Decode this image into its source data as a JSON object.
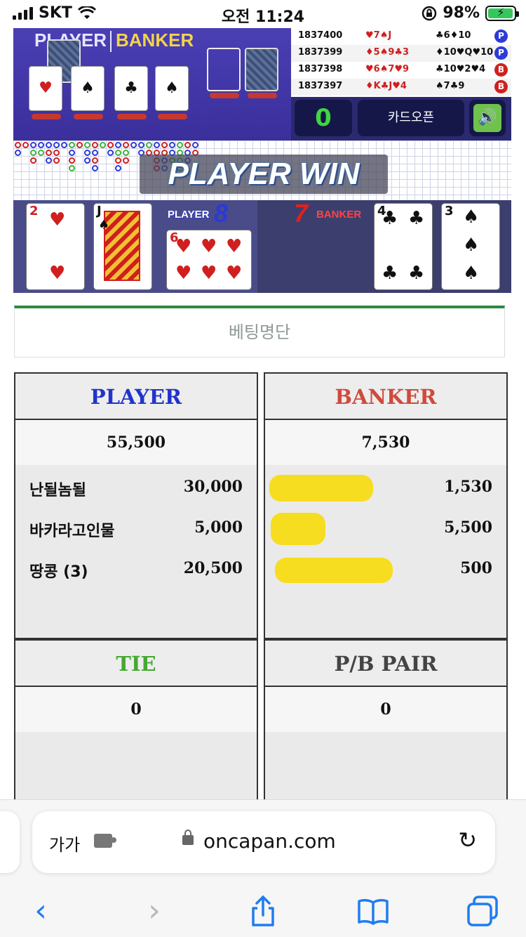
{
  "status": {
    "carrier": "SKT",
    "time": "오전 11:24",
    "battery": "98%",
    "battery_level": 0.98
  },
  "game": {
    "table_labels": {
      "player": "PLAYER",
      "banker": "BANKER"
    },
    "history": [
      {
        "id": "1837400",
        "player": "♥7♠J",
        "banker": "♣6♦10",
        "result": "P"
      },
      {
        "id": "1837399",
        "player": "♦5♠9♣3",
        "banker": "♦10♥Q♥10",
        "result": "P"
      },
      {
        "id": "1837398",
        "player": "♥6♠7♥9",
        "banker": "♣10♥2♥4",
        "result": "B"
      },
      {
        "id": "1837397",
        "player": "♦K♣J♥4",
        "banker": "♠7♣9",
        "result": "B"
      }
    ],
    "counter": "0",
    "open_button": "카드오픈",
    "win_text": "PLAYER WIN",
    "player_label": "PLAYER",
    "player_score": "8",
    "banker_label": "BANKER",
    "banker_score": "7",
    "player_cards": [
      {
        "rank": "2",
        "suit": "♥"
      },
      {
        "rank": "J",
        "suit": "♠"
      },
      {
        "rank": "6",
        "suit": "♥"
      }
    ],
    "banker_cards": [
      {
        "rank": "4",
        "suit": "♣"
      },
      {
        "rank": "3",
        "suit": "♠"
      }
    ]
  },
  "betting": {
    "title": "베팅명단",
    "player": {
      "title": "PLAYER",
      "total": "55,500",
      "rows": [
        {
          "name": "난될놈될",
          "amount": "30,000"
        },
        {
          "name": "바카라고인물",
          "amount": "5,000"
        },
        {
          "name": "땅콩 (3)",
          "amount": "20,500"
        }
      ]
    },
    "banker": {
      "title": "BANKER",
      "total": "7,530",
      "rows": [
        {
          "name": "",
          "amount": "1,530"
        },
        {
          "name": "",
          "amount": "5,500"
        },
        {
          "name": "",
          "amount": "500"
        }
      ]
    },
    "tie": {
      "title": "TIE",
      "total": "0"
    },
    "pair": {
      "title": "P/B  PAIR",
      "total": "0"
    },
    "colors": {
      "player": "#2233cc",
      "banker": "#cf4a3c",
      "tie": "#46a832",
      "pair": "#444444"
    }
  },
  "browser": {
    "aa": "가가",
    "url": "oncapan.com"
  }
}
